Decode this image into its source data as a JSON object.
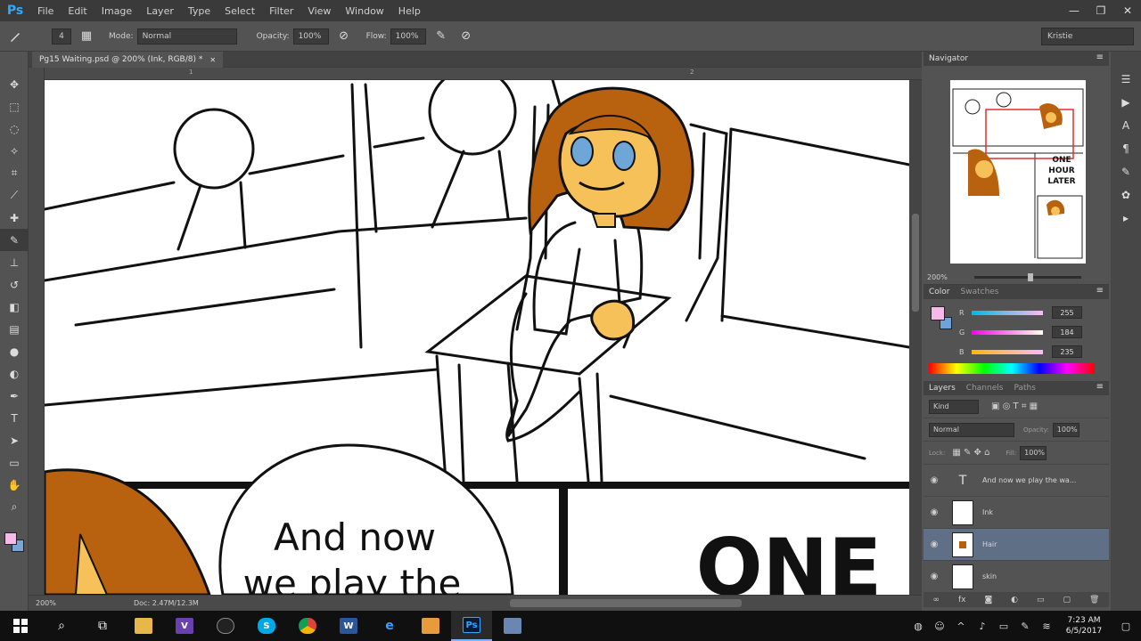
{
  "app": {
    "logo": "Ps"
  },
  "menu": [
    "File",
    "Edit",
    "Image",
    "Layer",
    "Type",
    "Select",
    "Filter",
    "View",
    "Window",
    "Help"
  ],
  "window_controls": {
    "minimize": "—",
    "restore": "❐",
    "close": "✕"
  },
  "options": {
    "brush_size": "4",
    "mode_label": "Mode:",
    "mode_value": "Normal",
    "opacity_label": "Opacity:",
    "opacity_value": "100%",
    "flow_label": "Flow:",
    "flow_value": "100%",
    "workspace": "Kristie"
  },
  "document": {
    "tab_title": "Pg15 Waiting.psd @ 200% (Ink, RGB/8) *",
    "tab_close": "✕",
    "status": "Doc: 2.47M/12.3M",
    "zoom_status": "200%",
    "ruler_marks": [
      "1",
      "2"
    ]
  },
  "comic": {
    "bubble_line1": "And now",
    "bubble_line2": "we play the",
    "big_text": "ONE"
  },
  "navigator": {
    "title": "Navigator",
    "zoom": "200%",
    "thumb_text1": "ONE",
    "thumb_text2": "HOUR",
    "thumb_text3": "LATER"
  },
  "color_panel": {
    "tab_active": "Color",
    "tab_other": "Swatches",
    "r_label": "R",
    "r_value": "255",
    "g_label": "G",
    "g_value": "184",
    "b_label": "B",
    "b_value": "235"
  },
  "layers_panel": {
    "tab_active": "Layers",
    "tab_channels": "Channels",
    "tab_paths": "Paths",
    "filter_kind": "Kind",
    "blend_mode": "Normal",
    "opacity_label": "Opacity:",
    "opacity_value": "100%",
    "lock_label": "Lock:",
    "fill_label": "Fill:",
    "fill_value": "100%",
    "layers": [
      {
        "name": "And now we play the wa...",
        "type": "text"
      },
      {
        "name": "Ink",
        "type": "raster"
      },
      {
        "name": "Hair",
        "type": "raster"
      },
      {
        "name": "skin",
        "type": "raster"
      }
    ]
  },
  "taskbar": {
    "clock_time": "7:23 AM",
    "clock_date": "6/5/2017"
  },
  "colors": {
    "foreground": "#f7b8ea",
    "background": "#79a6d8",
    "hair": "#b8620f",
    "skin": "#f7c15a",
    "eyes": "#6fa6d8",
    "selected_layer": "#5e6f86"
  },
  "icons": [
    "brush-icon",
    "move-icon",
    "marquee-icon",
    "lasso-icon",
    "quick-select-icon",
    "crop-icon",
    "eyedropper-icon",
    "healing-icon",
    "stamp-icon",
    "history-brush-icon",
    "eraser-icon",
    "gradient-icon",
    "blur-icon",
    "dodge-icon",
    "pen-icon",
    "type-icon",
    "path-select-icon",
    "shape-icon",
    "hand-icon",
    "zoom-icon",
    "eye-icon",
    "windows-start-icon",
    "search-icon"
  ]
}
